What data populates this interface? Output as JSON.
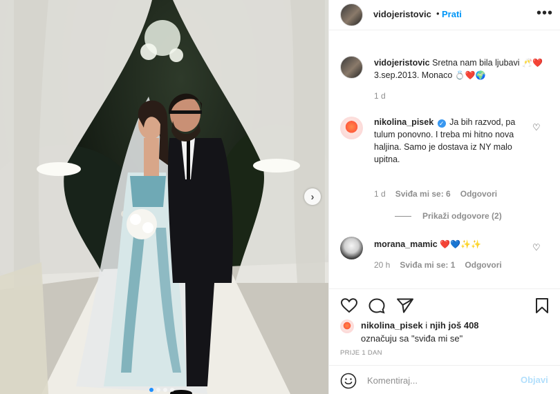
{
  "header": {
    "username": "vidojeristovic",
    "separator": "•",
    "follow_label": "Prati",
    "more_glyph": "•••"
  },
  "caption": {
    "username": "vidojeristovic",
    "text_part1": "Sretna nam bila ljubavi",
    "emoji_a": "🥂❤️",
    "text_part2": "3.sep.2013. Monaco",
    "emoji_b": "💍❤️🌍",
    "time": "1 d"
  },
  "comments": [
    {
      "username": "nikolina_pisek",
      "verified": true,
      "text": "Ja bih razvod, pa tulum ponovno. I treba mi hitno nova haljina. Samo je dostava iz NY malo upitna.",
      "time": "1 d",
      "likes": "Sviđa mi se: 6",
      "reply": "Odgovori",
      "view_replies": "Prikaži odgovore (2)"
    },
    {
      "username": "morana_mamic",
      "emoji": "❤️💙✨✨",
      "time": "20 h",
      "likes": "Sviđa mi se: 1",
      "reply": "Odgovori"
    }
  ],
  "likes_summary": {
    "user": "nikolina_pisek",
    "connector": "i",
    "others": "njih još 408",
    "line2": "označuju sa \"sviđa mi se\""
  },
  "date": "PRIJE 1 DAN",
  "comment_box": {
    "placeholder": "Komentiraj...",
    "post_label": "Objavi"
  },
  "carousel": {
    "next_glyph": "›",
    "count": 4,
    "active_index": 0
  },
  "icons": {
    "heart": "heart-icon",
    "comment": "comment-icon",
    "share": "share-icon",
    "save": "bookmark-icon",
    "emoji": "emoji-icon",
    "more": "more-icon"
  },
  "colors": {
    "accent": "#0095f6",
    "post_disabled": "#b2dffc",
    "muted": "#8e8e8e",
    "text": "#262626",
    "verified": "#3897f0"
  }
}
